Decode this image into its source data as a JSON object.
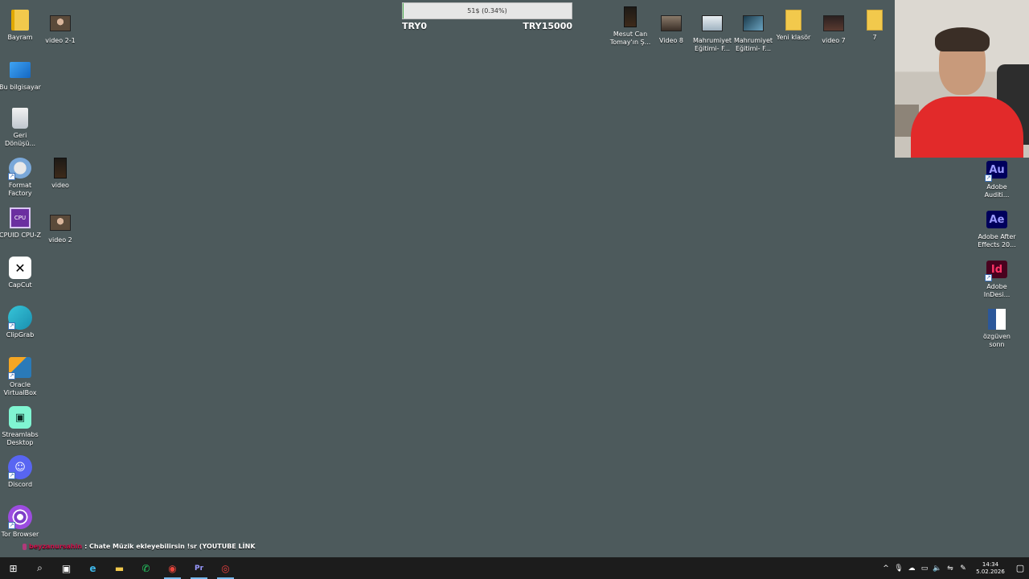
{
  "desktop": {
    "left_icons": [
      {
        "label": "Bayram",
        "icon": "folder-icon"
      },
      {
        "label": "video 2-1",
        "icon": "video-thumbnail-icon"
      },
      {
        "label": "Bu bilgisayar",
        "icon": "computer-icon"
      },
      {
        "label": "Geri Dönüşü...",
        "icon": "recycle-bin-icon"
      },
      {
        "label": "Format Factory",
        "icon": "format-factory-icon"
      },
      {
        "label": "video",
        "icon": "video-thumbnail-icon"
      },
      {
        "label": "CPUID CPU-Z",
        "icon": "cpuz-icon"
      },
      {
        "label": "video 2",
        "icon": "video-thumbnail-icon"
      },
      {
        "label": "CapCut",
        "icon": "capcut-icon"
      },
      {
        "label": "ClipGrab",
        "icon": "clipgrab-icon"
      },
      {
        "label": "Oracle VirtualBox",
        "icon": "virtualbox-icon"
      },
      {
        "label": "Streamlabs Desktop",
        "icon": "streamlabs-icon"
      },
      {
        "label": "Discord",
        "icon": "discord-icon"
      },
      {
        "label": "Tor Browser",
        "icon": "tor-browser-icon"
      }
    ],
    "top_icons": [
      {
        "label": "Mesut Can Tomay'ın Ş...",
        "icon": "video-thumbnail-icon"
      },
      {
        "label": "Video 8",
        "icon": "video-thumbnail-icon"
      },
      {
        "label": "Mahrumiyet Eğitimi- F...",
        "icon": "video-thumbnail-icon"
      },
      {
        "label": "Mahrumiyet Eğitimi- F...",
        "icon": "video-thumbnail-icon"
      },
      {
        "label": "Yeni klasör",
        "icon": "folder-icon"
      },
      {
        "label": "video 7",
        "icon": "video-thumbnail-icon"
      },
      {
        "label": "7",
        "icon": "folder-icon"
      }
    ],
    "right_icons": [
      {
        "label": "Adobe Auditi...",
        "icon": "adobe-audition-icon",
        "glyph": "Au"
      },
      {
        "label": "Adobe After Effects 20...",
        "icon": "adobe-after-effects-icon",
        "glyph": "Ae"
      },
      {
        "label": "Adobe InDesi...",
        "icon": "adobe-indesign-icon",
        "glyph": "Id"
      },
      {
        "label": "özgüven sonn",
        "icon": "word-document-icon",
        "glyph": "W"
      }
    ]
  },
  "donation_goal": {
    "progress_text": "51$ (0.34%)",
    "progress_fraction": 0.0034,
    "min_label": "TRY0",
    "max_label": "TRY15000",
    "fill_color": "#4caf50"
  },
  "chat": {
    "username": "beyzanursahin",
    "message": ": Chate Müzik ekleyebilirsin !sr (YOUTUBE LİNK"
  },
  "taskbar": {
    "apps": [
      {
        "name": "start",
        "glyph": "⊞"
      },
      {
        "name": "search",
        "glyph": "⌕"
      },
      {
        "name": "task-view",
        "glyph": "▣"
      },
      {
        "name": "edge",
        "glyph": "e"
      },
      {
        "name": "file-explorer",
        "glyph": "▬"
      },
      {
        "name": "whatsapp",
        "glyph": "✆"
      },
      {
        "name": "chrome",
        "glyph": "◉"
      },
      {
        "name": "premiere",
        "glyph": "Pr"
      },
      {
        "name": "streamlabs",
        "glyph": "◎"
      }
    ],
    "tray": {
      "chevron": "^",
      "time": "14:34",
      "date": "5.02.2026"
    }
  },
  "colors": {
    "desktop_bg": "#4d5a5c",
    "taskbar_bg": "#1c1c1c",
    "accent": "#76b9ed"
  }
}
